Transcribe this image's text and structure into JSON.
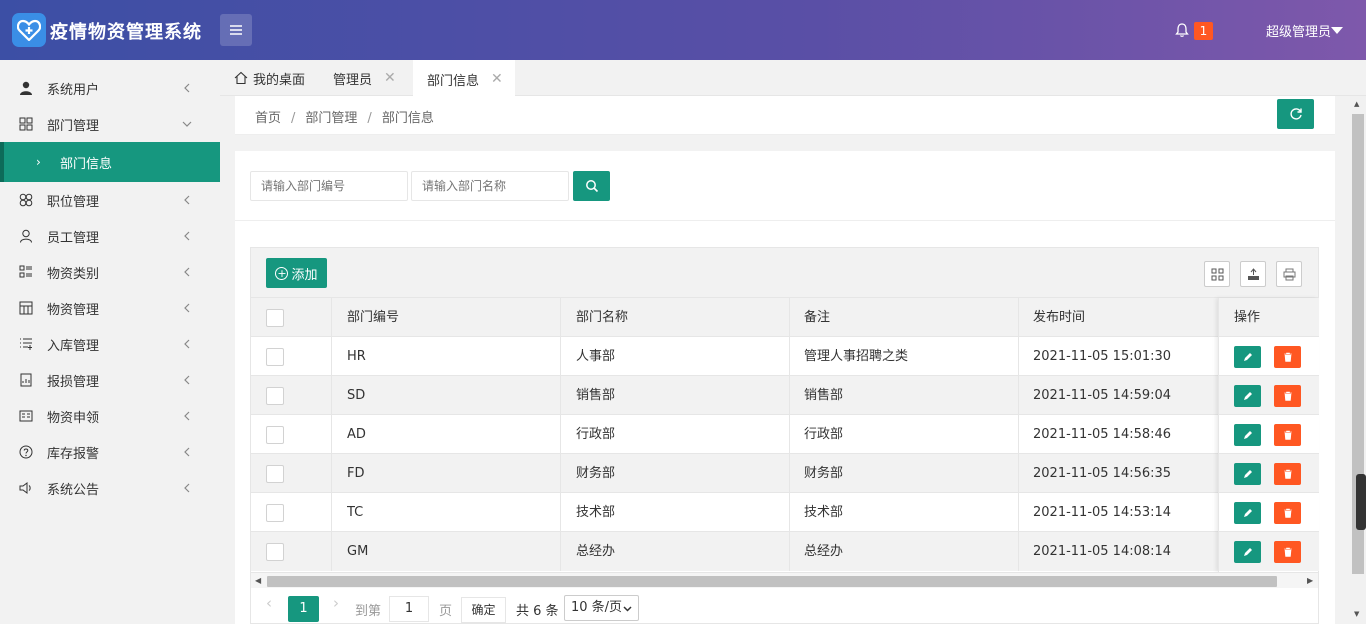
{
  "app": {
    "title": "疫情物资管理系统"
  },
  "header": {
    "notification_count": "1",
    "user_name": "超级管理员"
  },
  "sidebar": {
    "items": [
      {
        "label": "系统用户",
        "icon": "user-icon"
      },
      {
        "label": "部门管理",
        "icon": "grid-icon",
        "expanded": true
      },
      {
        "label": "部门信息",
        "active": true
      },
      {
        "label": "职位管理",
        "icon": "clover-icon"
      },
      {
        "label": "员工管理",
        "icon": "person-outline-icon"
      },
      {
        "label": "物资类别",
        "icon": "category-list-icon"
      },
      {
        "label": "物资管理",
        "icon": "calendar-grid-icon"
      },
      {
        "label": "入库管理",
        "icon": "list-add-icon"
      },
      {
        "label": "报损管理",
        "icon": "doc-chart-icon"
      },
      {
        "label": "物资申领",
        "icon": "form-card-icon"
      },
      {
        "label": "库存报警",
        "icon": "question-icon"
      },
      {
        "label": "系统公告",
        "icon": "speaker-icon"
      }
    ]
  },
  "tabs": [
    {
      "label": "我的桌面",
      "icon": "home-icon"
    },
    {
      "label": "管理员",
      "close": "✕"
    },
    {
      "label": "部门信息",
      "close": "✕",
      "active": true
    }
  ],
  "breadcrumb": {
    "home": "首页",
    "parent": "部门管理",
    "current": "部门信息",
    "separator": "/"
  },
  "search": {
    "code_placeholder": "请输入部门编号",
    "name_placeholder": "请输入部门名称"
  },
  "toolbar": {
    "add_label": "添加"
  },
  "table": {
    "columns": [
      "部门编号",
      "部门名称",
      "备注",
      "发布时间",
      "操作"
    ],
    "rows": [
      {
        "code": "HR",
        "name": "人事部",
        "remark": "管理人事招聘之类",
        "time": "2021-11-05 15:01:30"
      },
      {
        "code": "SD",
        "name": "销售部",
        "remark": "销售部",
        "time": "2021-11-05 14:59:04"
      },
      {
        "code": "AD",
        "name": "行政部",
        "remark": "行政部",
        "time": "2021-11-05 14:58:46"
      },
      {
        "code": "FD",
        "name": "财务部",
        "remark": "财务部",
        "time": "2021-11-05 14:56:35"
      },
      {
        "code": "TC",
        "name": "技术部",
        "remark": "技术部",
        "time": "2021-11-05 14:53:14"
      },
      {
        "code": "GM",
        "name": "总经办",
        "remark": "总经办",
        "time": "2021-11-05 14:08:14"
      }
    ]
  },
  "pager": {
    "current": "1",
    "goto_label": "到第",
    "goto_value": "1",
    "page_label": "页",
    "confirm_label": "确定",
    "total_label": "共 6 条",
    "page_size": "10 条/页"
  },
  "colors": {
    "primary": "#16977f",
    "danger": "#ff5722",
    "header_start": "#3c4fa5",
    "header_end": "#7e58ab"
  }
}
